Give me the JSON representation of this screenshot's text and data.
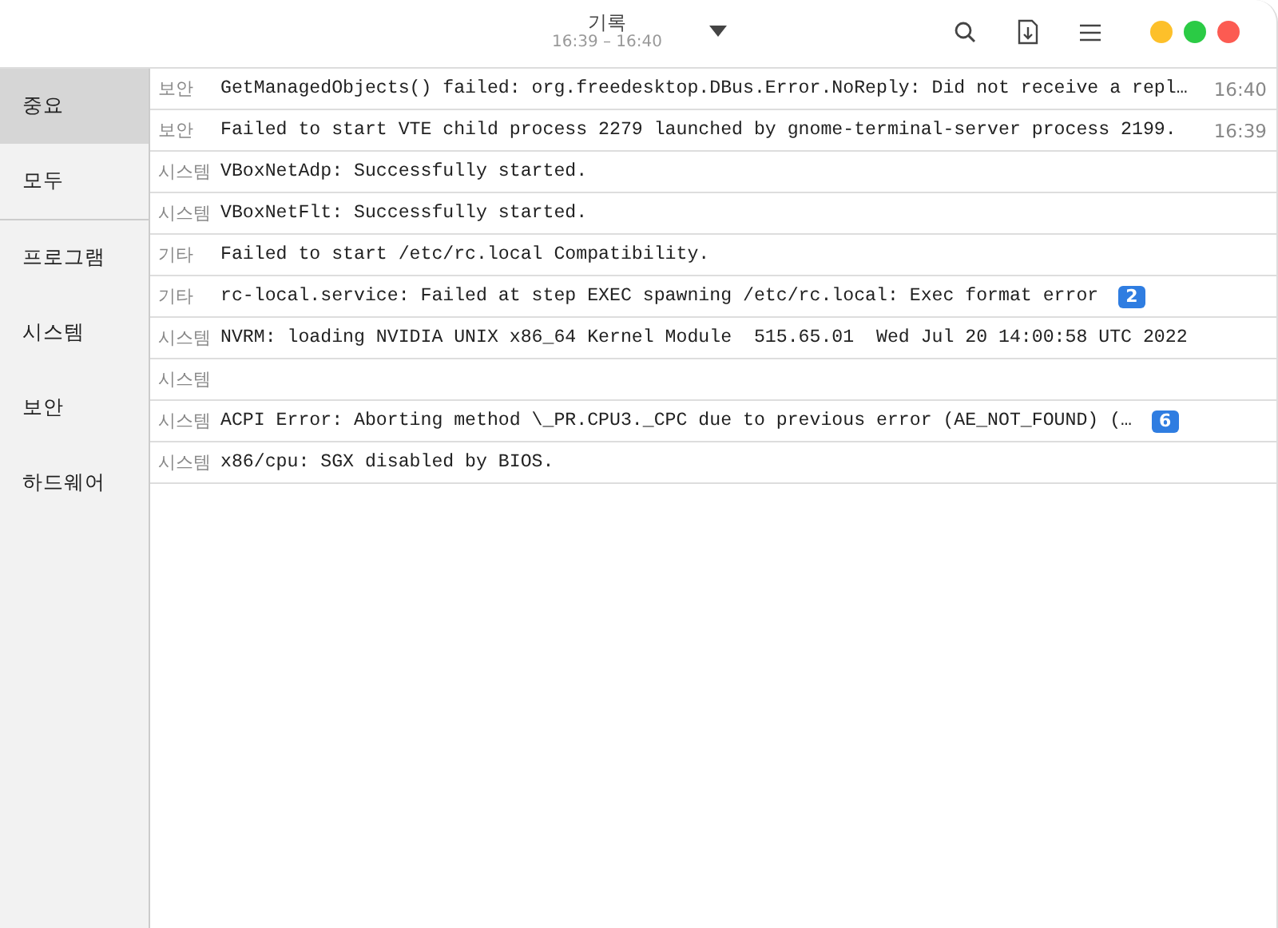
{
  "window": {
    "title": "기록",
    "subtitle": "16:39 – 16:40"
  },
  "sidebar": {
    "items": [
      {
        "label": "중요",
        "selected": true
      },
      {
        "label": "모두",
        "selected": false
      },
      {
        "label": "프로그램",
        "selected": false
      },
      {
        "label": "시스템",
        "selected": false
      },
      {
        "label": "보안",
        "selected": false
      },
      {
        "label": "하드웨어",
        "selected": false
      }
    ]
  },
  "log": {
    "rows": [
      {
        "category": "보안",
        "message": "GetManagedObjects() failed: org.freedesktop.DBus.Error.NoReply: Did not receive a repl…",
        "time": "16:40"
      },
      {
        "category": "보안",
        "message": "Failed to start VTE child process 2279 launched by gnome-terminal-server process 2199.",
        "time": "16:39"
      },
      {
        "category": "시스템",
        "message": "VBoxNetAdp: Successfully started."
      },
      {
        "category": "시스템",
        "message": "VBoxNetFlt: Successfully started."
      },
      {
        "category": "기타",
        "message": "Failed to start /etc/rc.local Compatibility."
      },
      {
        "category": "기타",
        "message": "rc-local.service: Failed at step EXEC spawning /etc/rc.local: Exec format error",
        "count": "2"
      },
      {
        "category": "시스템",
        "message": "NVRM: loading NVIDIA UNIX x86_64 Kernel Module  515.65.01  Wed Jul 20 14:00:58 UTC 2022"
      },
      {
        "category": "시스템"
      },
      {
        "category": "시스템",
        "message": "ACPI Error: Aborting method \\_PR.CPU3._CPC due to previous error (AE_NOT_FOUND) (…",
        "count": "6"
      },
      {
        "category": "시스템",
        "message": "x86/cpu: SGX disabled by BIOS."
      }
    ]
  }
}
